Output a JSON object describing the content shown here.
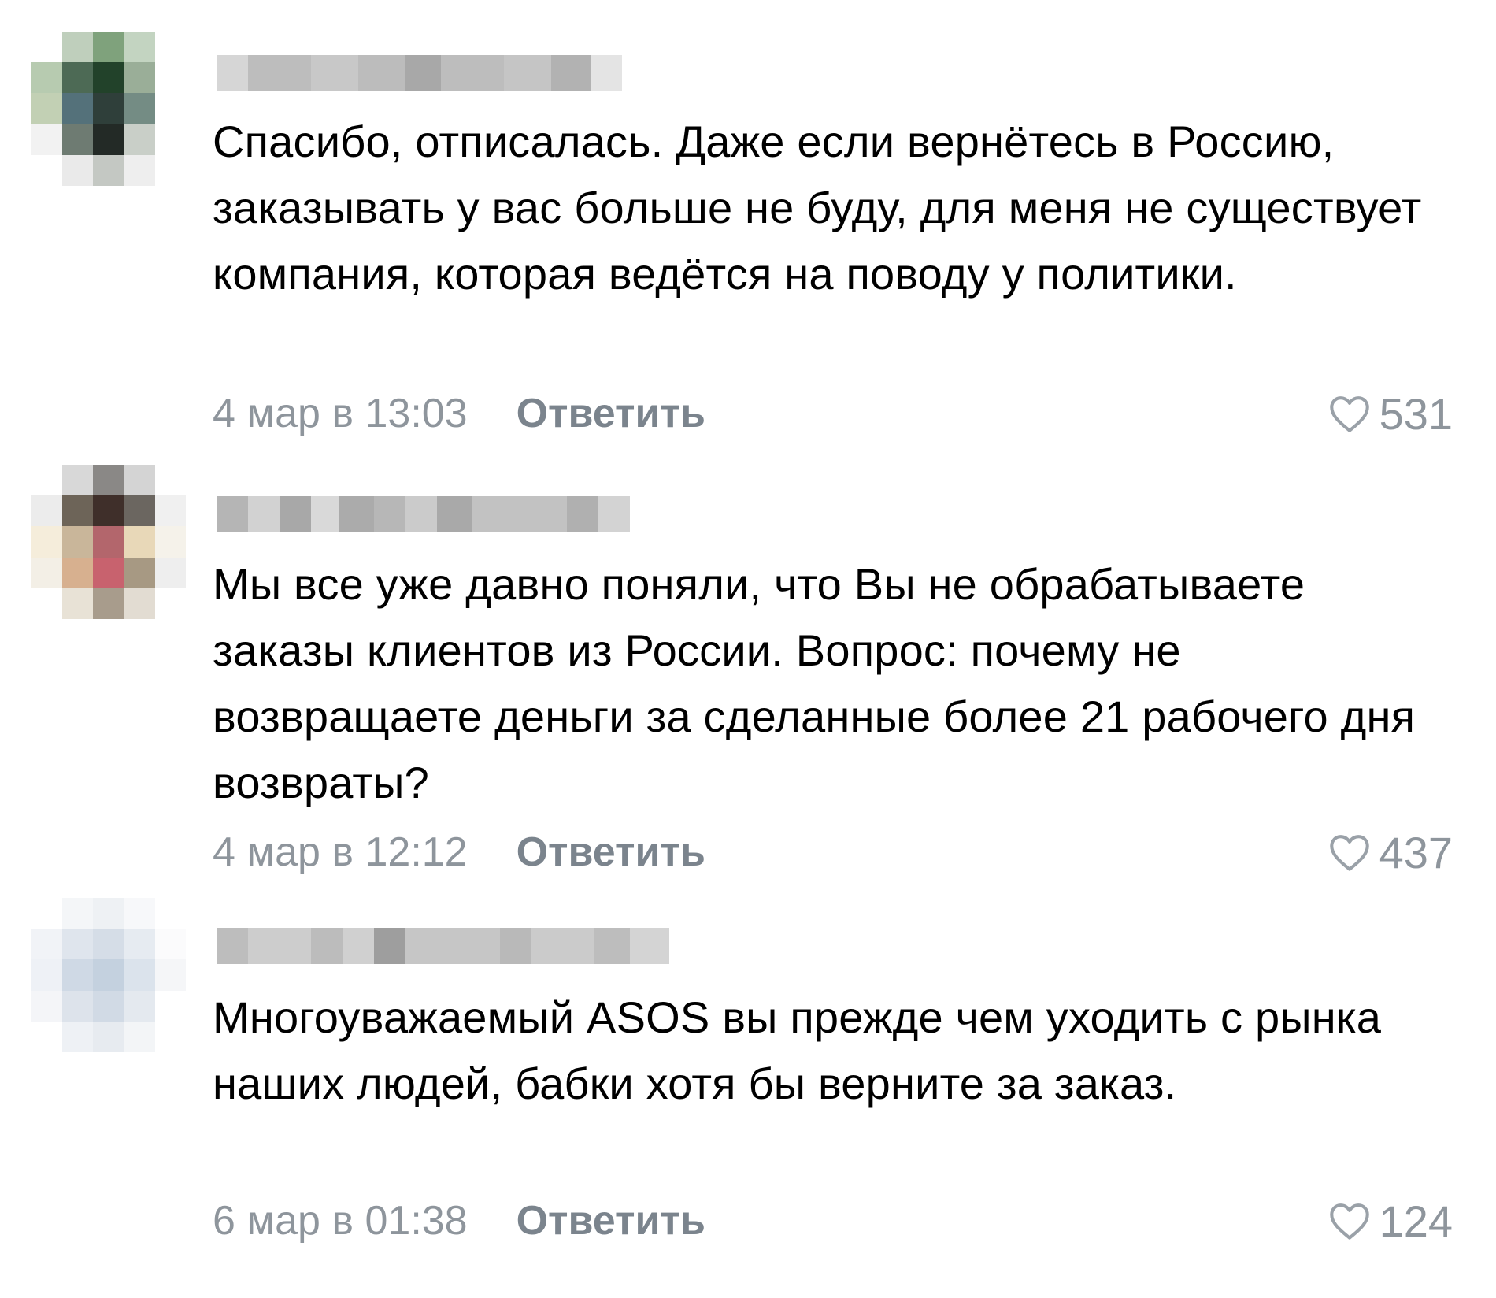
{
  "comments": [
    {
      "text": "Спасибо, отписалась. Даже если вернётесь в Россию, заказывать у вас больше не буду, для меня не существует компания, которая ведётся на поводу у политики.",
      "date": "4 мар в 13:03",
      "reply_label": "Ответить",
      "likes": "531",
      "avatar_colors": [
        "#ffffff",
        "#bfcfbc",
        "#7fa27c",
        "#c3d4c1",
        "#ffffff",
        "#b7cbb0",
        "#4d6a55",
        "#22422a",
        "#9aae98",
        "#ffffff",
        "#c2d0b4",
        "#54717a",
        "#2f3f3a",
        "#748c84",
        "#ffffff",
        "#f2f2f2",
        "#6e7b72",
        "#232a26",
        "#c9cfc8",
        "#ffffff",
        "#ffffff",
        "#eaeaea",
        "#c4c8c3",
        "#eeeeee",
        "#ffffff"
      ]
    },
    {
      "text": "Мы все уже давно поняли, что Вы не обрабатываете заказы клиентов из России. Вопрос: почему не возвращаете деньги за сделанные более 21 рабочего дня возвраты?",
      "date": "4 мар в 12:12",
      "reply_label": "Ответить",
      "likes": "437",
      "avatar_colors": [
        "#ffffff",
        "#d8d8d8",
        "#8a8886",
        "#d4d4d4",
        "#ffffff",
        "#ececec",
        "#6d6458",
        "#3f2f2a",
        "#6b6660",
        "#f0f0f0",
        "#f5eddb",
        "#c9b69a",
        "#b3666c",
        "#e8d8b8",
        "#f5f2ea",
        "#f3efe6",
        "#d7b08f",
        "#c8626e",
        "#a79983",
        "#eeeeee",
        "#ffffff",
        "#e8e2d6",
        "#a89c8c",
        "#e2dcd2",
        "#ffffff"
      ]
    },
    {
      "text": "Многоуважаемый ASOS вы прежде чем уходить с рынка наших людей, бабки хотя бы верните за заказ.",
      "date": "6 мар в 01:38",
      "reply_label": "Ответить",
      "likes": "124",
      "avatar_colors": [
        "#ffffff",
        "#f4f6f8",
        "#eef1f4",
        "#f7f8fa",
        "#ffffff",
        "#f1f3f7",
        "#dfe5ed",
        "#d5dde7",
        "#e6ebf1",
        "#fbfbfc",
        "#eef1f6",
        "#cfd9e5",
        "#c4d1df",
        "#dbe3ec",
        "#f5f6f8",
        "#f4f5f8",
        "#dde3eb",
        "#d1dae5",
        "#e4e9ef",
        "#ffffff",
        "#ffffff",
        "#eef1f5",
        "#e7ebf0",
        "#f3f5f7",
        "#ffffff"
      ]
    }
  ]
}
